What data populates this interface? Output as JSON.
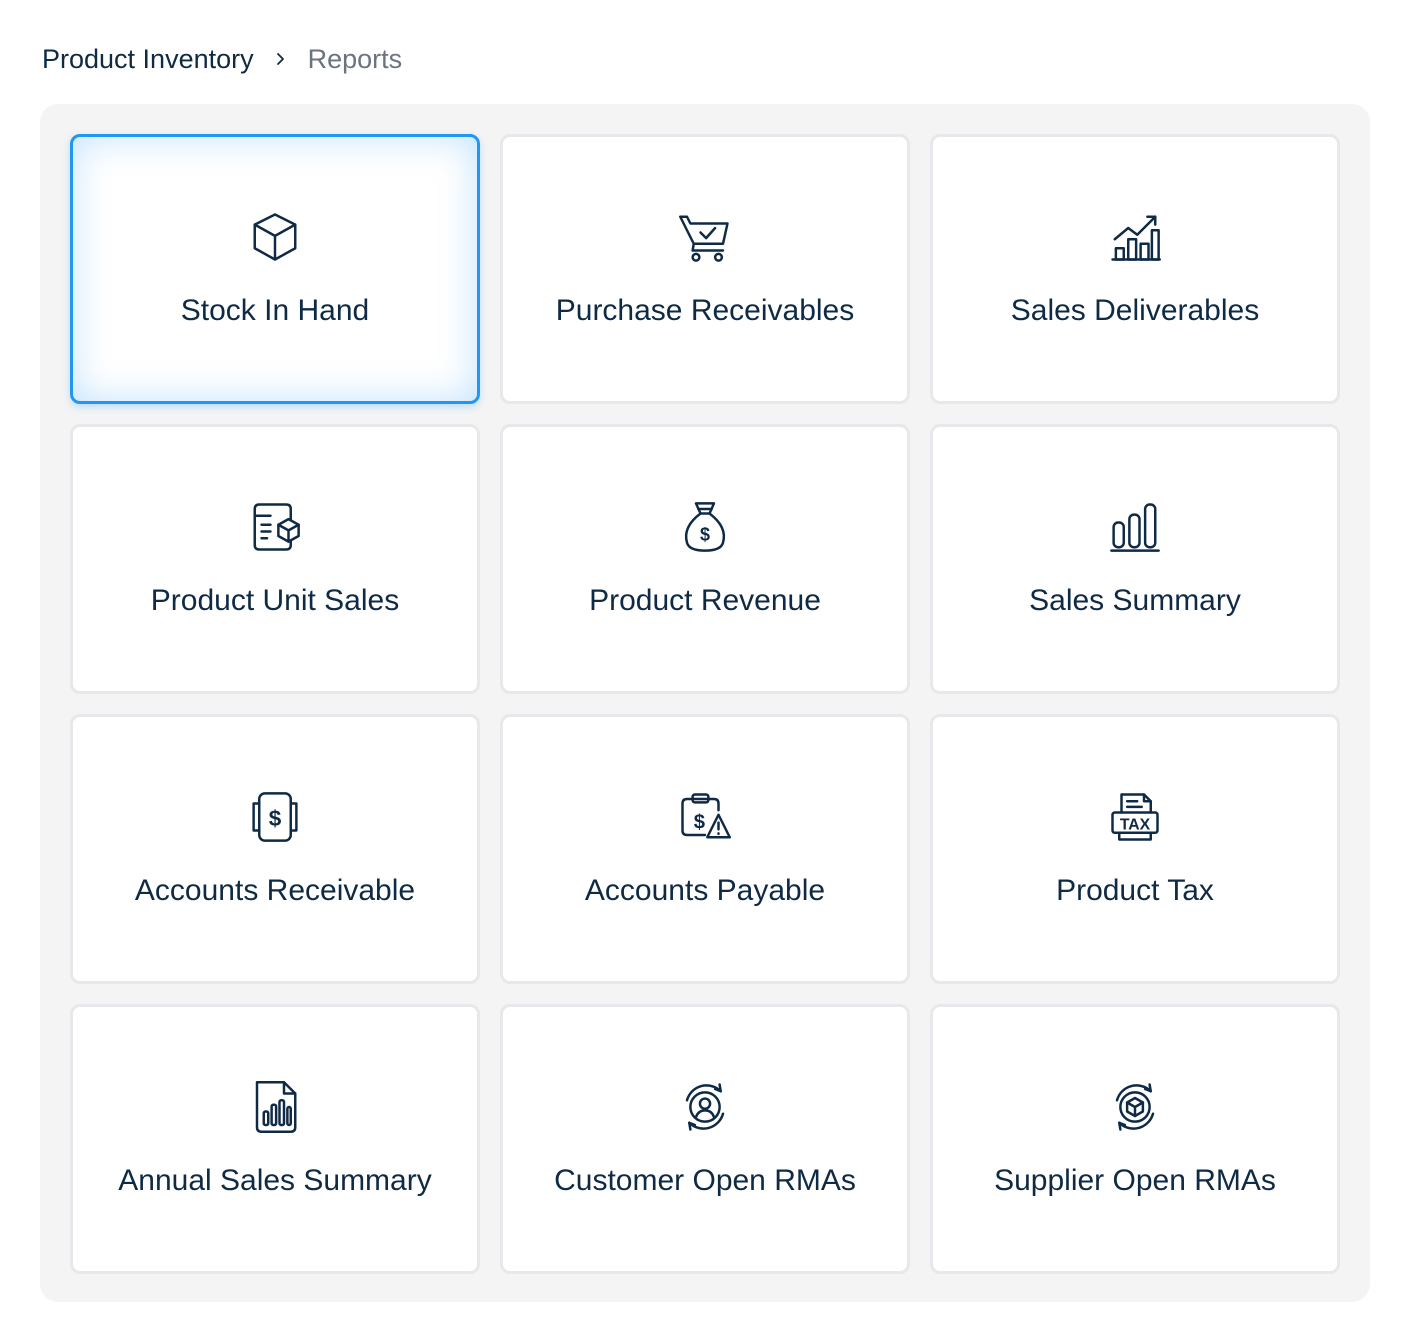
{
  "breadcrumb": {
    "root": "Product Inventory",
    "current": "Reports"
  },
  "cards": [
    {
      "label": "Stock In Hand",
      "icon": "box-icon",
      "selected": true
    },
    {
      "label": "Purchase Receivables",
      "icon": "cart-check-icon",
      "selected": false
    },
    {
      "label": "Sales Deliverables",
      "icon": "chart-growth-icon",
      "selected": false
    },
    {
      "label": "Product Unit Sales",
      "icon": "product-card-icon",
      "selected": false
    },
    {
      "label": "Product Revenue",
      "icon": "money-bag-icon",
      "selected": false
    },
    {
      "label": "Sales Summary",
      "icon": "bar-chart-icon",
      "selected": false
    },
    {
      "label": "Accounts Receivable",
      "icon": "dollar-receipt-icon",
      "selected": false
    },
    {
      "label": "Accounts Payable",
      "icon": "dollar-warning-icon",
      "selected": false
    },
    {
      "label": "Product Tax",
      "icon": "tax-document-icon",
      "selected": false
    },
    {
      "label": "Annual Sales Summary",
      "icon": "report-chart-icon",
      "selected": false
    },
    {
      "label": "Customer Open RMAs",
      "icon": "customer-return-icon",
      "selected": false
    },
    {
      "label": "Supplier Open RMAs",
      "icon": "supplier-return-icon",
      "selected": false
    }
  ],
  "colors": {
    "accent": "#2196f3",
    "text": "#0f2a44",
    "muted": "#6b7280",
    "panel": "#f4f4f4"
  }
}
